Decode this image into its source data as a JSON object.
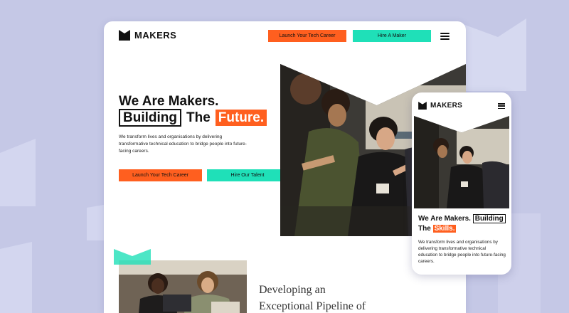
{
  "brand": {
    "name": "MAKERS",
    "mobile_name": "MAKERS"
  },
  "nav": {
    "cta_primary": "Launch Your Tech Career",
    "cta_secondary": "Hire A Maker"
  },
  "hero": {
    "line1": "We Are Makers.",
    "boxed_word": "Building",
    "plain_word": "The",
    "highlight_word": "Future.",
    "paragraph": "We transform lives and organisations by delivering transformative technical education to bridge people into future-facing careers.",
    "button_primary": "Launch Your Tech Career",
    "button_secondary": "Hire Our Talent"
  },
  "section2": {
    "heading_line1": "Developing an",
    "heading_line2": "Exceptional Pipeline of"
  },
  "mobile": {
    "line1": "We Are Makers.",
    "boxed_word": "Building",
    "plain_word": "The",
    "highlight_word": "Skills.",
    "paragraph": "We transform lives and organisations by delivering transformative technical education to bridge people into future-facing careers."
  },
  "icons": [
    "makers-logo-icon",
    "hamburger-menu-icon"
  ],
  "colors": {
    "accent_orange": "#ff5f1f",
    "accent_teal": "#1fe0b8",
    "background": "#c5c8e6"
  }
}
